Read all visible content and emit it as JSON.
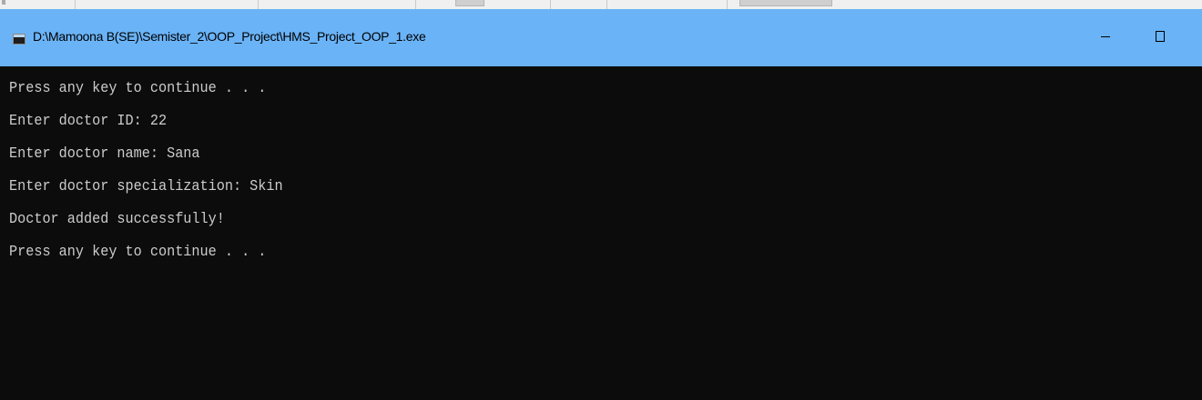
{
  "window": {
    "title": "D:\\Mamoona B(SE)\\Semister_2\\OOP_Project\\HMS_Project_OOP_1.exe",
    "icon": "console-app-icon",
    "controls": {
      "minimize": "minimize-icon",
      "maximize": "maximize-icon"
    },
    "colors": {
      "titlebar": "#6ab3f7",
      "console_background": "#0c0c0c",
      "console_text": "#cccccc"
    }
  },
  "console": {
    "lines": [
      "Press any key to continue . . .",
      "Enter doctor ID: 22",
      "Enter doctor name: Sana",
      "Enter doctor specialization: Skin",
      "Doctor added successfully!",
      "Press any key to continue . . ."
    ]
  }
}
